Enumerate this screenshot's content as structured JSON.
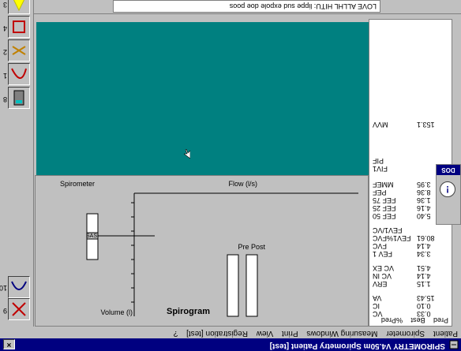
{
  "window": {
    "title": "SPIROMETRY V4.50m   Spirometry Patient [test]",
    "close_glyph": "×"
  },
  "menu": [
    "Patient",
    "Spirometer",
    "Measuring Windows",
    "Print",
    "View",
    "Registration [test]",
    "?"
  ],
  "status_text": "LOVE ALLHL HITU: lippe sud expole doe poos",
  "graph": {
    "ylabel": "Volume (l)",
    "flow_label": "Flow (l/s)",
    "title": "Spirogram",
    "top_left_label": "Spirometer",
    "pre_post_label": "Pre  Post",
    "small_box_text": "SAS"
  },
  "datapanel": {
    "header": [
      "Pred",
      "Best",
      "%Pred"
    ],
    "rows": [
      {
        "label": "VC",
        "value": "0.33"
      },
      {
        "label": "IC",
        "value": "0.10"
      },
      {
        "label": "VA",
        "value": "15.43"
      },
      {
        "label": "ERV",
        "value": "1.15"
      },
      {
        "label": "VC IN",
        "value": "4.14"
      },
      {
        "label": "VC EX",
        "value": "4.51"
      },
      {
        "label": "FEV 1",
        "value": "3.34"
      },
      {
        "label": "FVC",
        "value": "4.14"
      },
      {
        "label": "FEV1%FVC",
        "value": "80.61"
      },
      {
        "label": "FEV1/VC",
        "value": ""
      },
      {
        "label": "FEF 50",
        "value": "5.40"
      },
      {
        "label": "FEF 25",
        "value": "4.16"
      },
      {
        "label": "FEF 75",
        "value": "1.36"
      },
      {
        "label": "PEF",
        "value": "8.36"
      },
      {
        "label": "MMEF",
        "value": "3.95"
      },
      {
        "label": "FIV1",
        "value": ""
      },
      {
        "label": "PIF",
        "value": ""
      },
      {
        "label": "MVV",
        "value": "153.1"
      }
    ]
  },
  "toolbar": {
    "labels": [
      "9",
      "10",
      "8",
      "1",
      "2",
      "4",
      "3"
    ]
  },
  "popup": {
    "header": "DOS",
    "icon": "!"
  },
  "colors": {
    "teal": "#008080",
    "navy": "#000080",
    "face": "#c0c0c0"
  }
}
